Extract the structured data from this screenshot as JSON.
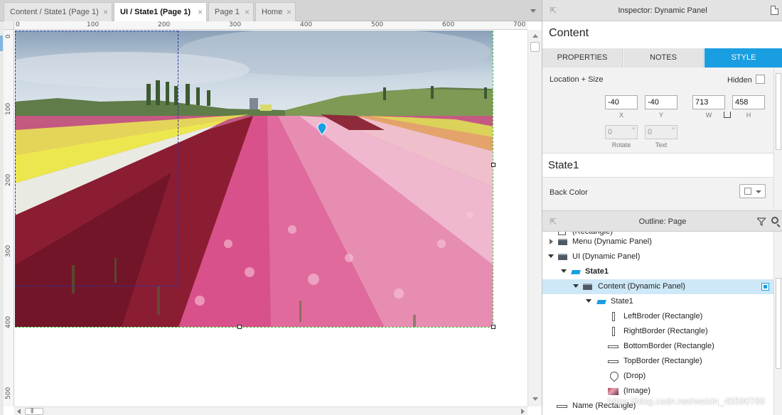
{
  "editor": {
    "tabs": [
      {
        "label": "Content / State1 (Page 1)",
        "active": false
      },
      {
        "label": "UI / State1 (Page 1)",
        "active": true
      },
      {
        "label": "Page 1",
        "active": false
      },
      {
        "label": "Home",
        "active": false
      }
    ],
    "close_glyph": "×",
    "hruler_labels": [
      "0",
      "100",
      "200",
      "300",
      "400",
      "500",
      "600",
      "700"
    ],
    "vruler_labels": [
      "0",
      "100",
      "200",
      "300",
      "400",
      "500"
    ]
  },
  "inspector": {
    "header": "Inspector: Dynamic Panel",
    "title": "Content",
    "tabs": [
      "PROPERTIES",
      "NOTES",
      "STYLE"
    ],
    "active_tab": "STYLE",
    "location_size_label": "Location + Size",
    "hidden_label": "Hidden",
    "x_value": "-40",
    "y_value": "-40",
    "w_value": "713",
    "h_value": "458",
    "x_caption": "X",
    "y_caption": "Y",
    "w_caption": "W",
    "h_caption": "H",
    "rotate_value": "0",
    "text_value": "0",
    "rotate_caption": "Rotate",
    "text_caption": "Text",
    "degree_glyph": "°",
    "state_title": "State1",
    "back_color_label": "Back Color"
  },
  "outline": {
    "header": "Outline: Page",
    "rows": [
      {
        "label": "(Rectangle)",
        "icon": "rect-icon"
      },
      {
        "label": "Menu (Dynamic Panel)",
        "icon": "dynamic-panel-icon"
      },
      {
        "label": "UI (Dynamic Panel)",
        "icon": "dynamic-panel-icon"
      },
      {
        "label": "State1",
        "icon": "state-icon"
      },
      {
        "label": "Content (Dynamic Panel)",
        "icon": "dynamic-panel-icon"
      },
      {
        "label": "State1",
        "icon": "state-icon"
      },
      {
        "label": "LeftBroder (Rectangle)",
        "icon": "rect-vertical-icon"
      },
      {
        "label": "RightBorder (Rectangle)",
        "icon": "rect-vertical-icon"
      },
      {
        "label": "BottomBorder (Rectangle)",
        "icon": "rect-horizontal-icon"
      },
      {
        "label": "TopBorder (Rectangle)",
        "icon": "rect-horizontal-icon"
      },
      {
        "label": "(Drop)",
        "icon": "drop-icon"
      },
      {
        "label": "(Image)",
        "icon": "image-icon"
      },
      {
        "label": "Name (Rectangle)",
        "icon": "rect-horizontal-icon"
      }
    ]
  },
  "watermark": "https://blog.csdn.net/weixin_45590789",
  "colors": {
    "accent": "#1a9ee2",
    "selection_row": "#cfe8f7",
    "guide_green": "#33cc33",
    "selection_dashed": "#2233aa"
  }
}
